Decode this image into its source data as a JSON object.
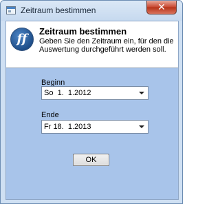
{
  "window": {
    "title": "Zeitraum bestimmen",
    "close_glyph": "✕"
  },
  "header": {
    "logo_text": "ff",
    "title": "Zeitraum bestimmen",
    "description": "Geben Sie den Zeitraum ein, für den die Auswertung durchgeführt werden soll."
  },
  "begin": {
    "label": "Beginn",
    "value": "So  1.  1.2012"
  },
  "end": {
    "label": "Ende",
    "value": "Fr 18.  1.2013"
  },
  "buttons": {
    "ok_label": "OK"
  },
  "colors": {
    "client_bg": "#a8c4ea",
    "titlebar": "#c6d9ef",
    "close_button": "#c7452e"
  }
}
